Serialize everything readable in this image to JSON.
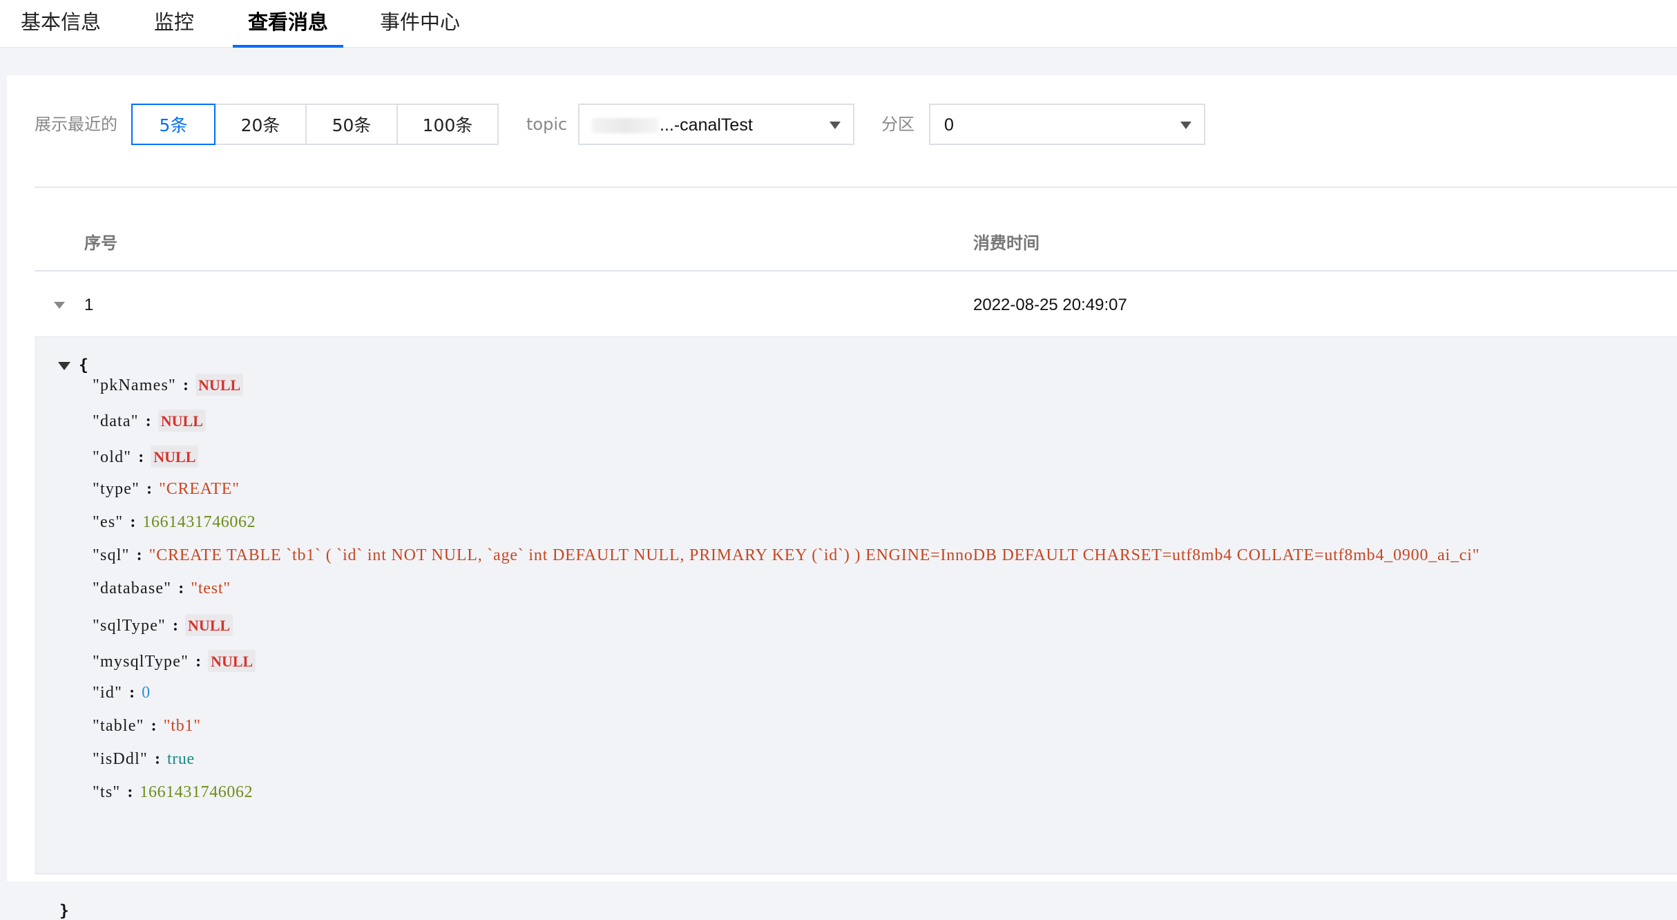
{
  "tabs": [
    {
      "label": "基本信息"
    },
    {
      "label": "监控"
    },
    {
      "label": "查看消息"
    },
    {
      "label": "事件中心"
    }
  ],
  "active_tab_index": 2,
  "filters": {
    "recent_label": "展示最近的",
    "counts": [
      "5条",
      "20条",
      "50条",
      "100条"
    ],
    "selected_count": "5条",
    "topic_label": "topic",
    "topic_value": "...-canalTest",
    "partition_label": "分区",
    "partition_value": "0"
  },
  "table": {
    "headers": {
      "index": "序号",
      "consume_time": "消费时间"
    },
    "rows": [
      {
        "index": "1",
        "consume_time": "2022-08-25 20:49:07"
      }
    ]
  },
  "message": {
    "open_brace": "{",
    "close_brace": "}",
    "separator": ":",
    "fields": [
      {
        "key": "\"pkNames\"",
        "value": "NULL",
        "type": "null"
      },
      {
        "key": "\"data\"",
        "value": "NULL",
        "type": "null"
      },
      {
        "key": "\"old\"",
        "value": "NULL",
        "type": "null"
      },
      {
        "key": "\"type\"",
        "value": "\"CREATE\"",
        "type": "string"
      },
      {
        "key": "\"es\"",
        "value": "1661431746062",
        "type": "number"
      },
      {
        "key": "\"sql\"",
        "value": "\"CREATE TABLE `tb1` ( `id` int NOT NULL, `age` int DEFAULT NULL, PRIMARY KEY (`id`) ) ENGINE=InnoDB DEFAULT CHARSET=utf8mb4 COLLATE=utf8mb4_0900_ai_ci\"",
        "type": "string"
      },
      {
        "key": "\"database\"",
        "value": "\"test\"",
        "type": "string"
      },
      {
        "key": "\"sqlType\"",
        "value": "NULL",
        "type": "null"
      },
      {
        "key": "\"mysqlType\"",
        "value": "NULL",
        "type": "null"
      },
      {
        "key": "\"id\"",
        "value": "0",
        "type": "number-zero"
      },
      {
        "key": "\"table\"",
        "value": "\"tb1\"",
        "type": "string"
      },
      {
        "key": "\"isDdl\"",
        "value": "true",
        "type": "boolean"
      },
      {
        "key": "\"ts\"",
        "value": "1661431746062",
        "type": "number"
      }
    ]
  },
  "colors": {
    "accent": "#006eff",
    "string": "#c8461f",
    "null": "#d6332c",
    "number": "#6b8d17",
    "boolean": "#158a8a"
  }
}
